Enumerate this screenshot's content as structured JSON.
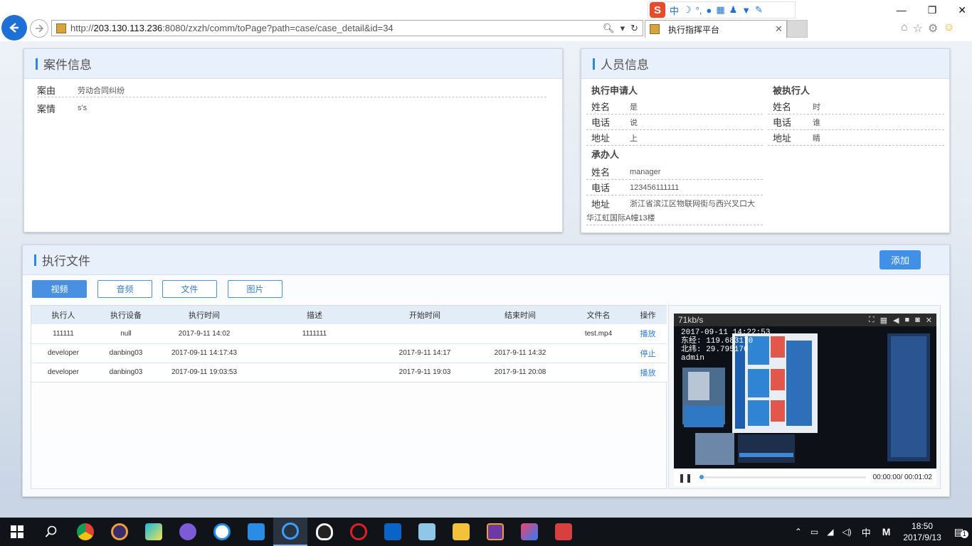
{
  "browser": {
    "url_prefix": "http://",
    "url_host": "203.130.113.236",
    "url_rest": ":8080/zxzh/comm/toPage?path=case/case_detail&id=34",
    "tab_title": "执行指挥平台"
  },
  "case_info": {
    "title": "案件信息",
    "rows": [
      {
        "label": "案由",
        "value": "劳动合同纠纷"
      },
      {
        "label": "案情",
        "value": "s's"
      }
    ]
  },
  "person_info": {
    "title": "人员信息",
    "applicant": {
      "heading": "执行申请人",
      "rows": [
        {
          "label": "姓名",
          "value": "是"
        },
        {
          "label": "电话",
          "value": "说"
        },
        {
          "label": "地址",
          "value": "上"
        }
      ]
    },
    "respondent": {
      "heading": "被执行人",
      "rows": [
        {
          "label": "姓名",
          "value": "时"
        },
        {
          "label": "电话",
          "value": "谁"
        },
        {
          "label": "地址",
          "value": "睛"
        }
      ]
    },
    "handler": {
      "heading": "承办人",
      "rows": [
        {
          "label": "姓名",
          "value": "manager"
        },
        {
          "label": "电话",
          "value": "123456111111"
        },
        {
          "label": "地址",
          "value": "浙江省滨江区物联网街与西兴叉口大"
        }
      ],
      "address_cont": "华江虹国际A幢13楼"
    }
  },
  "files": {
    "title": "执行文件",
    "add_label": "添加",
    "tabs": [
      "视频",
      "音频",
      "文件",
      "图片"
    ],
    "columns": [
      "执行人",
      "执行设备",
      "执行时间",
      "描述",
      "开始时间",
      "结束时间",
      "文件名",
      "操作"
    ],
    "rows": [
      [
        "111111",
        "null",
        "2017-9-11 14:02",
        "1111111",
        "",
        "",
        "test.mp4",
        "播放"
      ],
      [
        "developer",
        "danbing03",
        "2017-09-11 14:17:43",
        "",
        "2017-9-11 14:17",
        "2017-9-11 14:32",
        "",
        "停止"
      ],
      [
        "developer",
        "danbing03",
        "2017-09-11 19:03:53",
        "",
        "2017-9-11 19:03",
        "2017-9-11 20:08",
        "",
        "播放"
      ]
    ]
  },
  "player": {
    "bitrate": "71kb/s",
    "osd_time": "2017-09-11 14:22:53",
    "osd_lng": "东经: 119.683170",
    "osd_lat": "北纬: 29.795170",
    "osd_user": "admin",
    "time": "00:00:00/ 00:01:02",
    "progress": 0.0
  },
  "taskbar": {
    "ime_lang": "中",
    "ime_mode": "M",
    "time": "18:50",
    "date": "2017/9/13",
    "notif_count": "1"
  }
}
